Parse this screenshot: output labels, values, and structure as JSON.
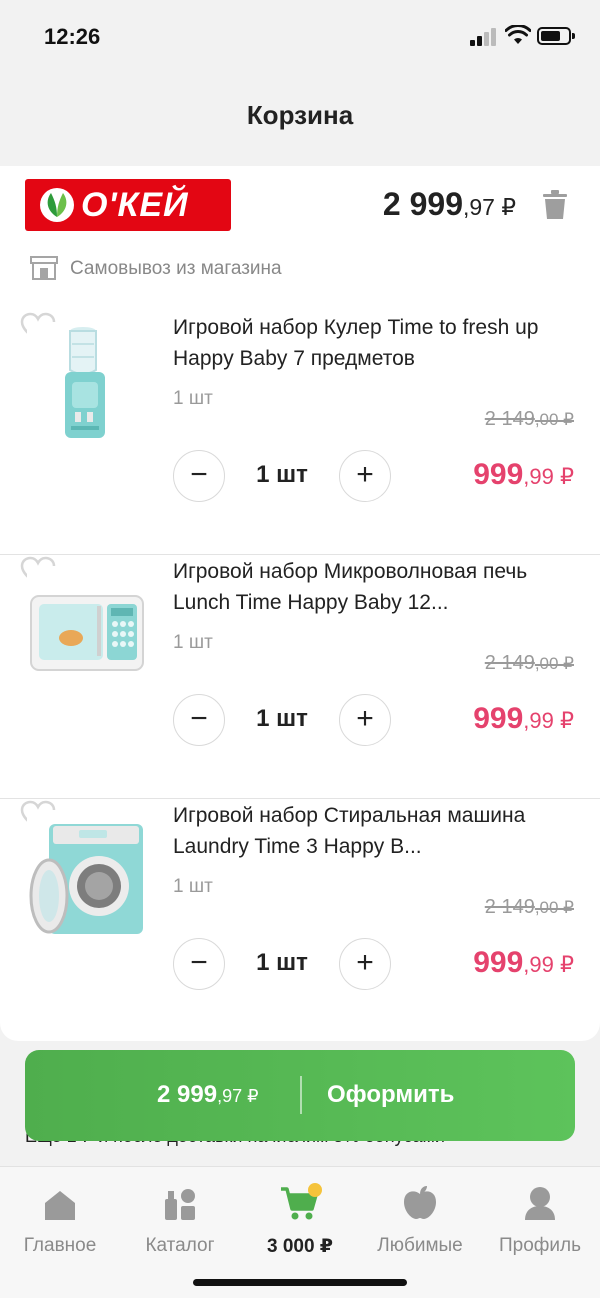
{
  "status_bar": {
    "time": "12:26"
  },
  "header": {
    "title": "Корзина"
  },
  "store": {
    "logo_text": "О'КЕЙ",
    "total_main": "2 999",
    "total_cents": ",97 ₽",
    "pickup_label": "Самовывоз из магазина"
  },
  "items": [
    {
      "name": "Игровой набор Кулер Time to fresh up Happy Baby 7 предметов",
      "qty_label": "1 шт",
      "old_price_main": "2 149",
      "old_price_cents": ",00 ₽",
      "stepper_value": "1 шт",
      "price_main": "999",
      "price_cents": ",99 ₽",
      "image_icon": "water-cooler-toy-image"
    },
    {
      "name": "Игровой набор Микроволновая печь Lunch Time Happy Baby 12...",
      "qty_label": "1 шт",
      "old_price_main": "2 149",
      "old_price_cents": ",00 ₽",
      "stepper_value": "1 шт",
      "price_main": "999",
      "price_cents": ",99 ₽",
      "image_icon": "microwave-toy-image"
    },
    {
      "name": "Игровой набор Стиральная машина Laundry Time 3 Happy B...",
      "qty_label": "1 шт",
      "old_price_main": "2 149",
      "old_price_cents": ",00 ₽",
      "stepper_value": "1 шт",
      "price_main": "999",
      "price_cents": ",99 ₽",
      "image_icon": "washing-machine-toy-image"
    }
  ],
  "stepper": {
    "minus": "−",
    "plus": "+"
  },
  "checkout": {
    "total_main": "2 999",
    "total_cents": ",97 ₽",
    "label": "Оформить",
    "bonus_note": "Еще 1 ₽ и после доставки начислим 5% бонусами"
  },
  "tabbar": {
    "home": "Главное",
    "catalog": "Каталог",
    "cart": "3 000 ₽",
    "favorites": "Любимые",
    "profile": "Профиль"
  },
  "colors": {
    "accent_green": "#5dc35b",
    "price_red": "#e5426d",
    "brand_red": "#e30613",
    "badge_yellow": "#f5c33b"
  }
}
